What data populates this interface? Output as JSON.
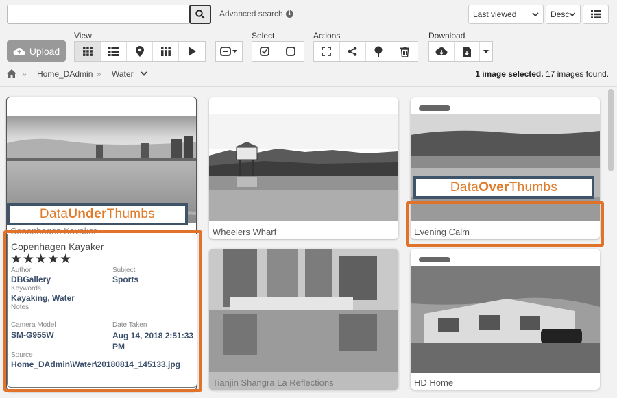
{
  "search": {
    "placeholder": "",
    "advanced_label": "Advanced search"
  },
  "sort": {
    "selected": "Last viewed",
    "order": "Desc"
  },
  "toolbar": {
    "upload_label": "Upload",
    "view_label": "View",
    "select_label": "Select",
    "actions_label": "Actions",
    "download_label": "Download"
  },
  "breadcrumb": {
    "items": [
      "Home_DAdmin",
      "Water"
    ]
  },
  "status": {
    "selected": "1 image selected.",
    "found": "17 images found."
  },
  "cards": [
    {
      "title": "Copenhagen Kayaker"
    },
    {
      "title": "Wheelers Wharf"
    },
    {
      "title": "Evening Calm"
    },
    {
      "title": "Tianjin Shangra La Reflections"
    },
    {
      "title": "HD Home"
    }
  ],
  "callouts": {
    "under": {
      "pre": "Data ",
      "bold": "Under",
      "post": " Thumbs"
    },
    "over": {
      "pre": "Data ",
      "bold": "Over",
      "post": " Thumbs"
    }
  },
  "details": {
    "title": "Copenhagen Kayaker",
    "rating": "★★★★★",
    "author_label": "Author",
    "author": "DBGallery",
    "subject_label": "Subject",
    "subject": "Sports",
    "keywords_label": "Keywords",
    "keywords": "Kayaking, Water",
    "notes_label": "Notes",
    "camera_label": "Camera Model",
    "camera": "SM-G955W",
    "date_label": "Date Taken",
    "date": "Aug 14, 2018 2:51:33 PM",
    "source_label": "Source",
    "source": "Home_DAdmin\\Water\\20180814_145133.jpg"
  },
  "colors": {
    "callout_border": "#3f5369",
    "callout_text": "#e07b2a",
    "highlight": "#e0722a",
    "value_text": "#3b4f6b"
  }
}
